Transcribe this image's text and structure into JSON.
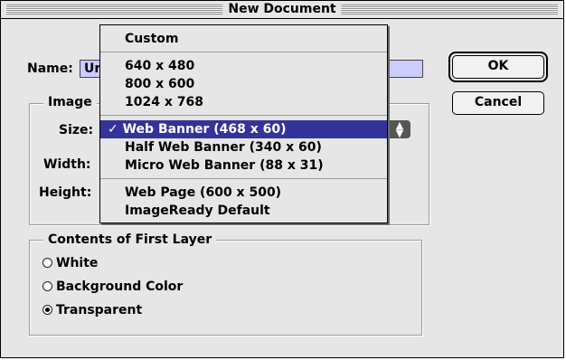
{
  "window": {
    "title": "New Document"
  },
  "form": {
    "name_label": "Name:",
    "name_value": "Ur",
    "image_group_title": "Image",
    "size_label": "Size:",
    "width_label": "Width:",
    "height_label": "Height:"
  },
  "buttons": {
    "ok": "OK",
    "cancel": "Cancel"
  },
  "contents_group": {
    "title": "Contents of First Layer",
    "options": [
      {
        "label": "White",
        "selected": false
      },
      {
        "label": "Background Color",
        "selected": false
      },
      {
        "label": "Transparent",
        "selected": true
      }
    ]
  },
  "size_menu": {
    "checkmark": "✓",
    "selected_index": 4,
    "items": [
      "Custom",
      "640 x 480",
      "800 x 600",
      "1024 x 768",
      "Web Banner (468 x 60)",
      "Half Web Banner (340 x 60)",
      "Micro Web Banner (88 x 31)",
      "Web Page (600 x 500)",
      "ImageReady Default"
    ]
  },
  "colors": {
    "selection": "#333399",
    "name_field_bg": "#ccccff",
    "dialog_bg": "#e6e6e6"
  }
}
